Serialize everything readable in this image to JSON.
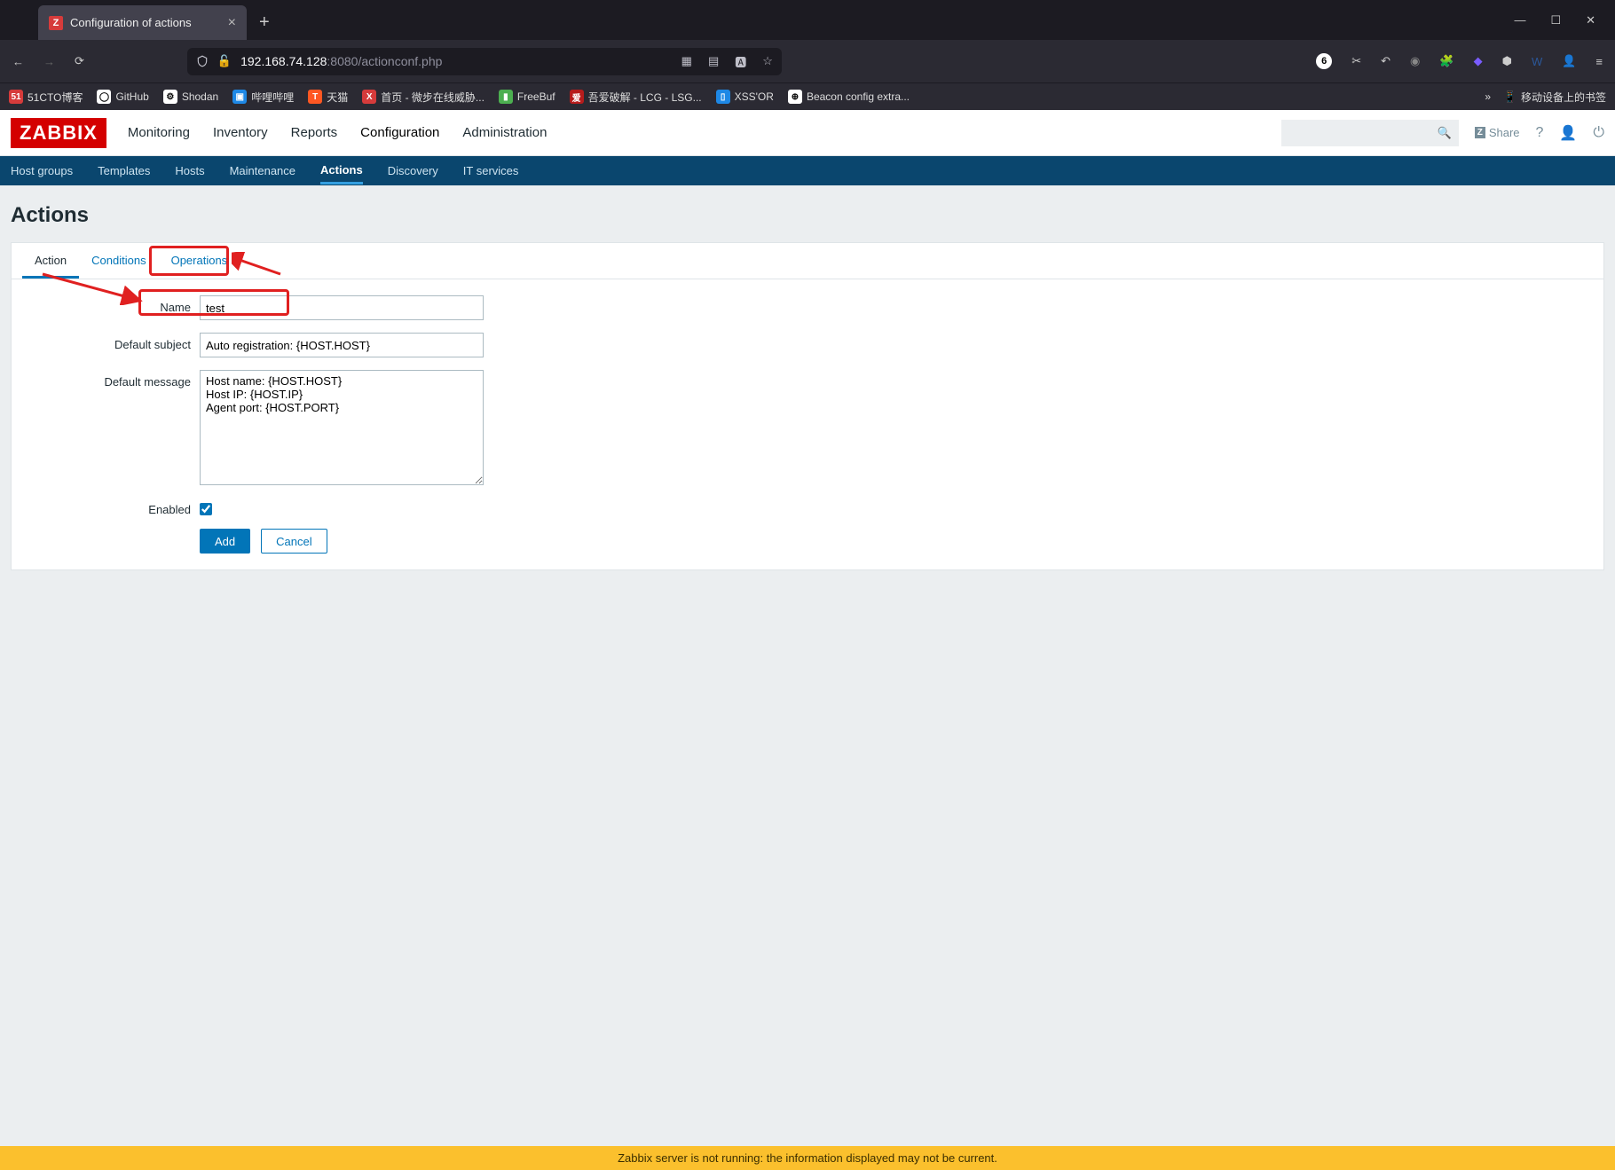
{
  "browser": {
    "tab_title": "Configuration of actions",
    "url_host": "192.168.74.128",
    "url_port_path": ":8080/actionconf.php",
    "badge_number": "6",
    "mobile_bookmarks": "移动设备上的书签"
  },
  "bookmarks": [
    "51CTO博客",
    "GitHub",
    "Shodan",
    "哔哩哔哩",
    "天猫",
    "首页 - 微步在线威胁...",
    "FreeBuf",
    "吾爱破解 - LCG - LSG...",
    "XSS'OR",
    "Beacon config extra..."
  ],
  "zabbix": {
    "logo": "ZABBIX",
    "main_nav": [
      "Monitoring",
      "Inventory",
      "Reports",
      "Configuration",
      "Administration"
    ],
    "main_nav_active": "Configuration",
    "share": "Share",
    "sub_nav": [
      "Host groups",
      "Templates",
      "Hosts",
      "Maintenance",
      "Actions",
      "Discovery",
      "IT services"
    ],
    "sub_nav_active": "Actions",
    "page_title": "Actions",
    "form_tabs": [
      "Action",
      "Conditions",
      "Operations"
    ],
    "form_tab_active": "Action",
    "fields": {
      "name_label": "Name",
      "name_value": "test",
      "subject_label": "Default subject",
      "subject_value": "Auto registration: {HOST.HOST}",
      "message_label": "Default message",
      "message_value": "Host name: {HOST.HOST}\nHost IP: {HOST.IP}\nAgent port: {HOST.PORT}",
      "enabled_label": "Enabled",
      "enabled_checked": true
    },
    "buttons": {
      "add": "Add",
      "cancel": "Cancel"
    },
    "footer_warning": "Zabbix server is not running: the information displayed may not be current."
  }
}
